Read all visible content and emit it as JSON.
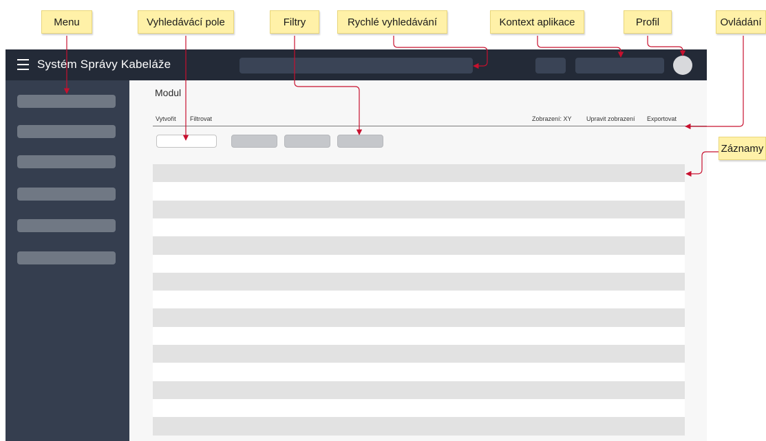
{
  "app": {
    "title": "Systém Správy Kabeláže",
    "menu_item_count": 6
  },
  "main": {
    "module_title": "Modul",
    "toolbar": {
      "create": "Vytvořit",
      "filter": "Filtrovat",
      "view": "Zobrazení: XY",
      "edit_view": "Upravit zobrazení",
      "export": "Exportovat"
    },
    "filter_count": 3,
    "record_row_count": 15
  },
  "annotations": {
    "menu": "Menu",
    "search_field": "Vyhledávácí pole",
    "filters": "Filtry",
    "quick_search": "Rychlé vyhledávání",
    "app_context": "Kontext aplikace",
    "profile": "Profil",
    "controls": "Ovládání",
    "records": "Záznamy"
  },
  "colors": {
    "topbar": "#232a37",
    "sidebar": "#353e4f",
    "note_fill": "#fff1a8",
    "connector": "#c8102e"
  }
}
